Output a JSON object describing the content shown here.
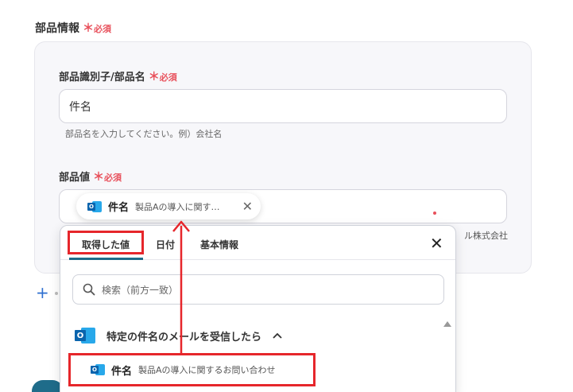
{
  "section": {
    "title": "部品情報",
    "required_star": "＊",
    "required_label": "必須"
  },
  "field1": {
    "label": "部品識別子/部品名",
    "required_star": "＊",
    "required_label": "必須",
    "value": "件名",
    "hint": "部品名を入力してください。例）会社名"
  },
  "field2": {
    "label": "部品値",
    "required_star": "＊",
    "required_label": "必須",
    "chip_title": "件名",
    "chip_value": "製品Aの導入に関す…",
    "behind_text": "ル株式会社"
  },
  "dropdown": {
    "tabs": [
      "取得した値",
      "日付",
      "基本情報"
    ],
    "active_tab": "取得した値",
    "search_placeholder": "検索（前方一致）",
    "group_label": "特定の件名のメールを受信したら",
    "item_title": "件名",
    "item_value": "製品Aの導入に関するお問い合わせ"
  },
  "icons": {
    "outlook_letter": "O",
    "close": "✕",
    "plus": "+"
  },
  "colors": {
    "required": "#e8505b",
    "highlight": "#e6262b",
    "accent": "#1f6c8a",
    "outlook": "#0a64ad"
  }
}
